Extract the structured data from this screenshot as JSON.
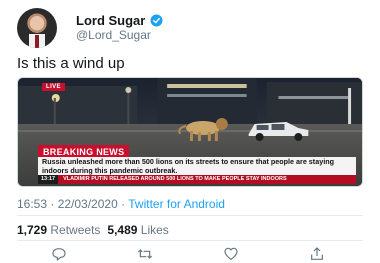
{
  "user": {
    "display_name": "Lord Sugar",
    "handle": "@Lord_Sugar",
    "verified_color": "#1da1f2"
  },
  "tweet": {
    "text": "Is this a wind up",
    "timestamp": "16:53 · 22/03/2020",
    "source": "Twitter for Android"
  },
  "media": {
    "live_label": "LIVE",
    "breaking_label": "BREAKING NEWS",
    "headline": "Russia unleashed more than 500 lions on its streets to ensure that people are staying indoors during this pandemic outbreak.",
    "ticker_time": "13:17",
    "ticker_text": "VLADIMIR PUTIN RELEASED AROUND 500 LIONS TO MAKE PEOPLE STAY INDOORS",
    "accent_color": "#c8102e"
  },
  "stats": {
    "retweets_count": "1,729",
    "retweets_label": "Retweets",
    "likes_count": "5,489",
    "likes_label": "Likes"
  },
  "actions": {
    "icons": [
      "reply-icon",
      "retweet-icon",
      "like-icon",
      "share-icon"
    ]
  }
}
